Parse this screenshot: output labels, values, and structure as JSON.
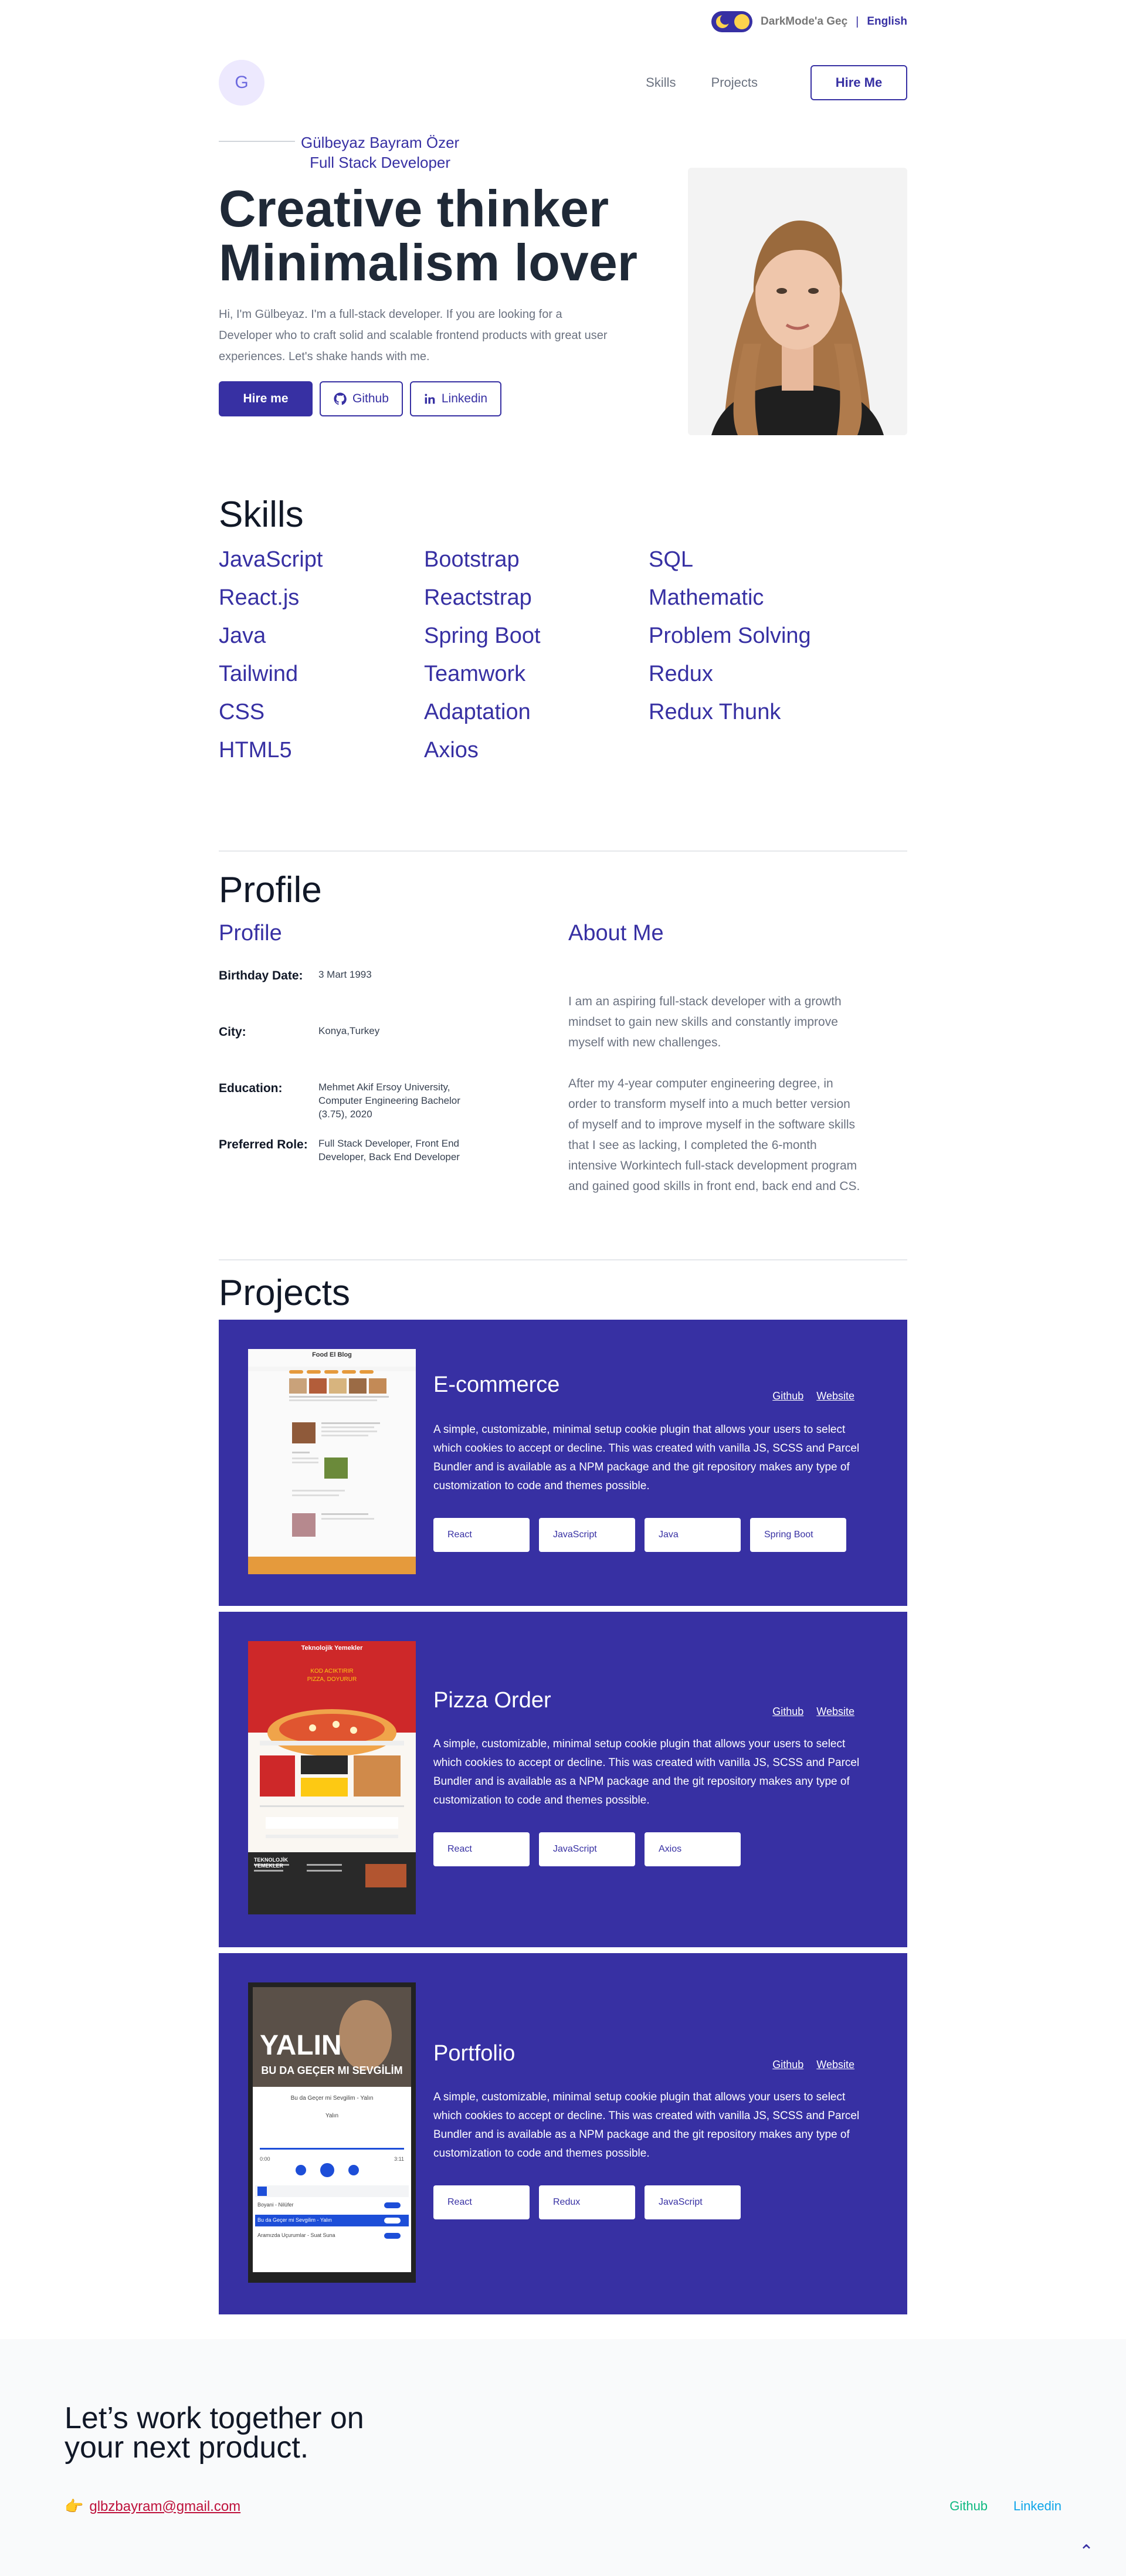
{
  "topbar": {
    "dark_mode_label": "DarkMode'a Geç",
    "separator": "|",
    "language": "English"
  },
  "nav": {
    "logo_letter": "G",
    "links": [
      "Skills",
      "Projects"
    ],
    "hire_button": "Hire Me"
  },
  "hero": {
    "name": "Gülbeyaz Bayram Özer",
    "role": "Full Stack Developer",
    "title_line1": "Creative thinker",
    "title_line2": "Minimalism lover",
    "description": "Hi, I'm Gülbeyaz. I'm a full-stack developer. If you are looking for a Developer who to craft solid and scalable frontend products with great user experiences. Let's shake hands with me.",
    "hire_button": "Hire me",
    "github_button": "Github",
    "linkedin_button": "Linkedin"
  },
  "skills": {
    "title": "Skills",
    "items": [
      "JavaScript",
      "React.js",
      "Java",
      "Tailwind",
      "CSS",
      "HTML5",
      "Bootstrap",
      "Reactstrap",
      "Spring Boot",
      "Teamwork",
      "Adaptation",
      "Axios",
      "SQL",
      "Mathematic",
      "Problem Solving",
      "Redux",
      "Redux Thunk"
    ]
  },
  "profile": {
    "title": "Profile",
    "subtitle_left": "Profile",
    "subtitle_right": "About Me",
    "rows": [
      {
        "label": "Birthday Date:",
        "value": "3 Mart 1993"
      },
      {
        "label": "City:",
        "value": "Konya,Turkey"
      },
      {
        "label": "Education:",
        "value": "Mehmet Akif Ersoy University, Computer Engineering Bachelor (3.75), 2020"
      },
      {
        "label": "Preferred Role:",
        "value": "Full Stack Developer, Front End Developer, Back End Developer"
      }
    ],
    "about_p1": "I am an aspiring full-stack developer with a growth mindset to gain new skills and constantly improve myself with new challenges.",
    "about_p2": "After my 4-year computer engineering degree, in order to transform myself into a much better version of myself and to improve myself in the software skills that I see as lacking, I completed the 6-month intensive Workintech full-stack development program and gained good skills in front end, back end and CS."
  },
  "projects": {
    "title": "Projects",
    "link_github": "Github",
    "link_website": "Website",
    "items": [
      {
        "title": "E-commerce",
        "description": "A simple, customizable, minimal setup cookie plugin that allows your users to select which cookies to accept or decline. This was created with vanilla JS, SCSS and Parcel Bundler and is available as a NPM package and the git repository makes any type of customization to code and themes possible.",
        "tags": [
          "React",
          "JavaScript",
          "Java",
          "Spring Boot"
        ],
        "shot_title": "Food El Blog"
      },
      {
        "title": "Pizza Order",
        "description": "A simple, customizable, minimal setup cookie plugin that allows your users to select which cookies to accept or decline. This was created with vanilla JS, SCSS and Parcel Bundler and is available as a NPM package and the git repository makes any type of customization to code and themes possible.",
        "tags": [
          "React",
          "JavaScript",
          "Axios"
        ],
        "shot_title": "Teknolojik Yemekler",
        "shot_sub1": "KOD ACIKTIRIR",
        "shot_sub2": "PIZZA, DOYURUR",
        "shot_footer": "TEKNOLOJİK YEMEKLER"
      },
      {
        "title": "Portfolio",
        "description": "A simple, customizable, minimal setup cookie plugin that allows your users to select which cookies to accept or decline. This was created with vanilla JS, SCSS and Parcel Bundler and is available as a NPM package and the git repository makes any type of customization to code and themes possible.",
        "tags": [
          "React",
          "Redux",
          "JavaScript"
        ],
        "shot_artist": "YALIN",
        "shot_song": "BU DA GEÇER MI SEVGİLİM",
        "shot_line1": "Bu da Geçer mi Sevgilim - Yalın",
        "shot_line2": "Yalın",
        "shot_time_start": "0:00",
        "shot_time_end": "3:11",
        "shot_list1": "Boyani - Nilüfer",
        "shot_list2": "Bu da Geçer mi Sevgilim - Yalın",
        "shot_list3": "Aramızda Uçurumlar - Suat Suna"
      }
    ]
  },
  "footer": {
    "title_line1": "Let’s work together on",
    "title_line2": "your next product.",
    "email": "glbzbayram@gmail.com",
    "github": "Github",
    "linkedin": "Linkedin"
  },
  "colors": {
    "primary": "#3730a3",
    "github_link": "#10b981",
    "linkedin_link": "#0ea5e9",
    "email": "#be123c"
  }
}
